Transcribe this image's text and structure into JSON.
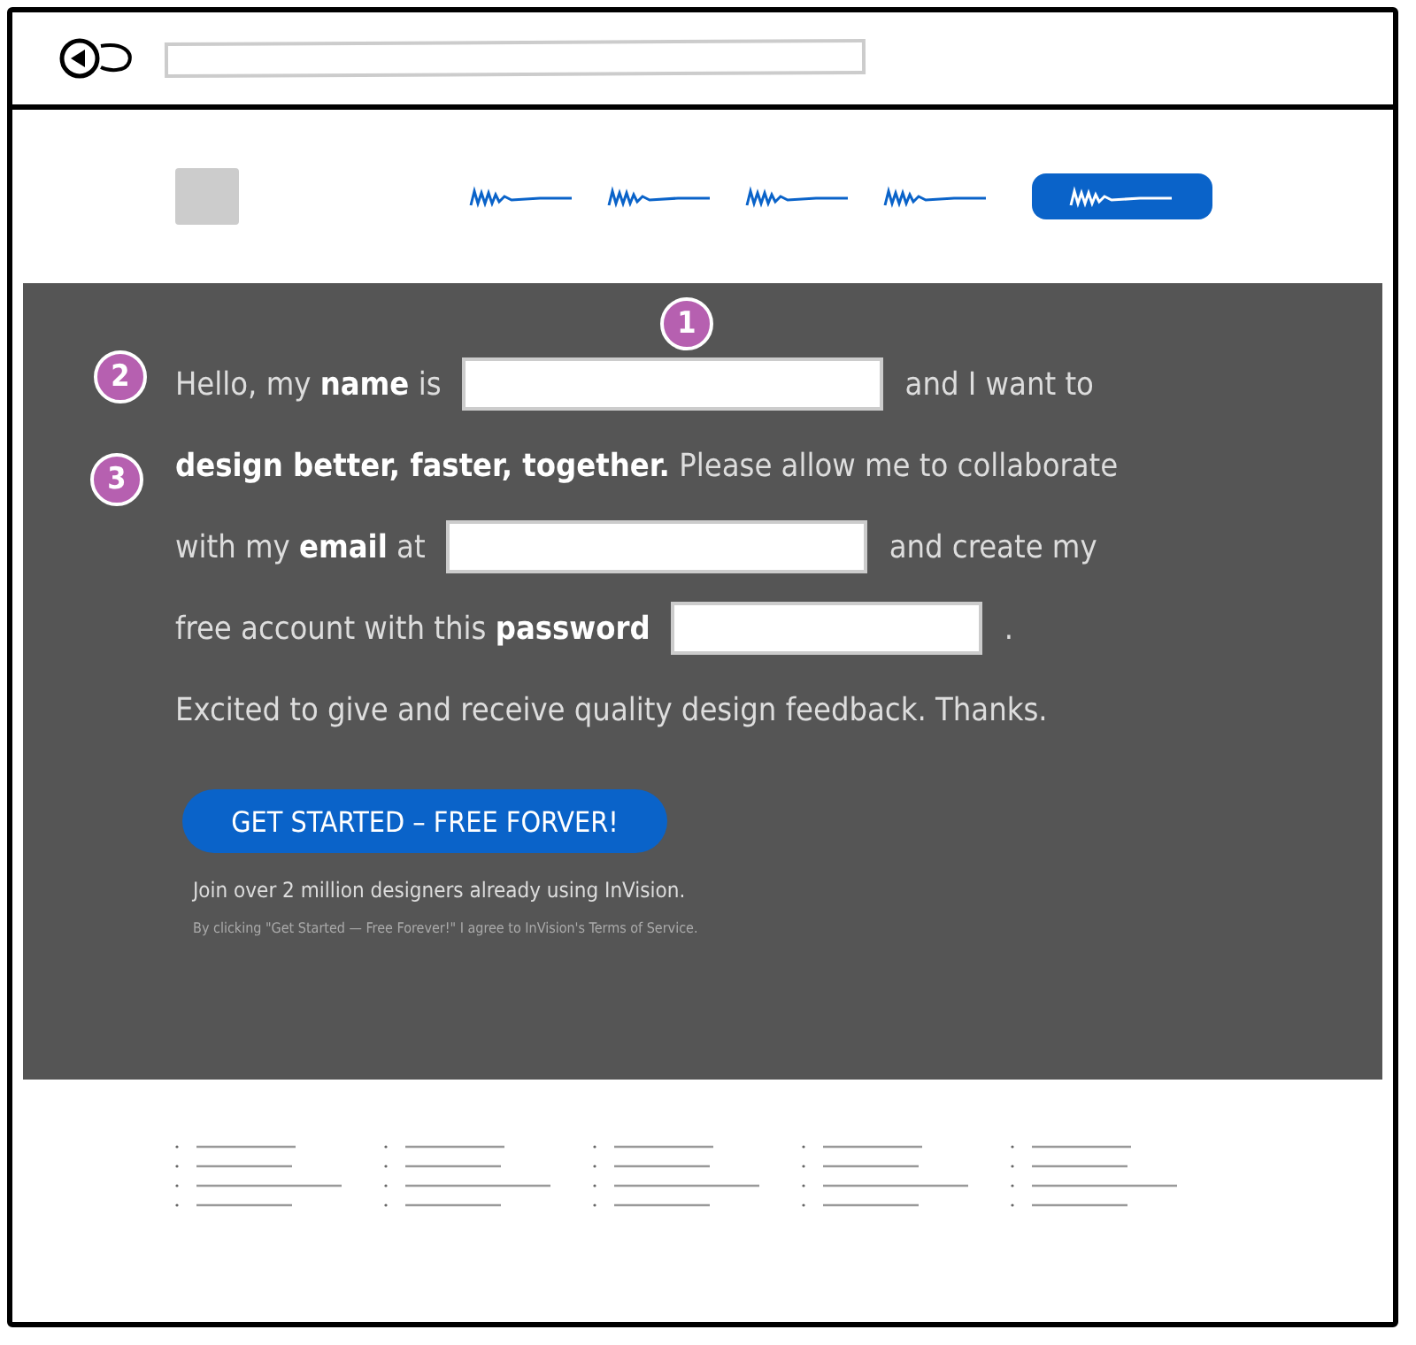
{
  "browser": {
    "kind": "address_bar"
  },
  "nav": [
    {
      "kind": "link"
    },
    {
      "kind": "link"
    },
    {
      "kind": "link"
    },
    {
      "kind": "link"
    },
    {
      "kind": "button"
    }
  ],
  "markers": [
    {
      "number": "1"
    },
    {
      "number": "2"
    },
    {
      "number": "3"
    }
  ],
  "form_lines": [
    [
      {
        "kind": "text",
        "text": "Hello, my **name** is"
      },
      {
        "kind": "field"
      },
      {
        "kind": "text",
        "text": "and I want to"
      }
    ],
    [
      {
        "kind": "text",
        "text": "**design better, faster, together.** Please allow me to collaborate"
      }
    ],
    [
      {
        "kind": "text",
        "text": "with my **email** at"
      },
      {
        "kind": "field"
      },
      {
        "kind": "text",
        "text": "and create my"
      }
    ],
    [
      {
        "kind": "text",
        "text": "free account with this **password**"
      },
      {
        "kind": "field"
      },
      {
        "kind": "text",
        "text": "."
      }
    ],
    [
      {
        "kind": "text",
        "text": "Excited to give and receive quality design feedback. Thanks."
      }
    ]
  ],
  "cta": {
    "label": "GET STARTED – FREE FORVER!"
  },
  "tagline": "Join over 2 million designers already using InVision.",
  "legal": "By clicking \"Get Started — Free Forever!\" I agree to InVision's Terms of Service."
}
